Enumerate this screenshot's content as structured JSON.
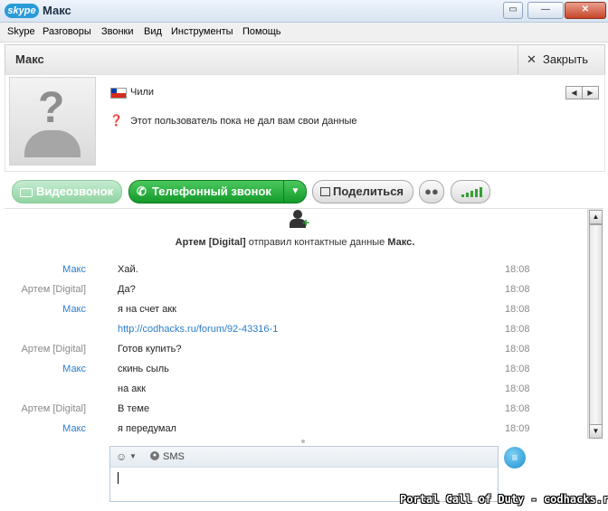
{
  "window": {
    "logo_text": "skype",
    "title": "Макс",
    "controls": [
      "▭",
      "—",
      "✕"
    ]
  },
  "menu": [
    "Skype",
    "Разговоры",
    "Звонки",
    "Вид",
    "Инструменты",
    "Помощь"
  ],
  "header": {
    "contact_name": "Макс",
    "close_label": "Закрыть"
  },
  "profile": {
    "country": "Чили",
    "info_text": "Этот пользователь пока не дал вам свои данные",
    "nav_prev": "◀",
    "nav_next": "▶"
  },
  "toolbar": {
    "video_call": "Видеозвонок",
    "phone_call": "Телефонный звонок",
    "share": "Поделиться"
  },
  "chat": {
    "system": {
      "sender": "Артем [Digital]",
      "text": "отправил контактные данные",
      "target": "Макс."
    },
    "messages": [
      {
        "sender": "Макс",
        "text": "Хай.",
        "time": "18:08"
      },
      {
        "sender": "Артем [Digital]",
        "text": "Да?",
        "time": "18:08"
      },
      {
        "sender": "Макс",
        "text": "я на счет акк",
        "time": "18:08"
      },
      {
        "sender": "",
        "text": "http://codhacks.ru/forum/92-43316-1",
        "time": "18:08"
      },
      {
        "sender": "Артем [Digital]",
        "text": "Готов купить?",
        "time": "18:08"
      },
      {
        "sender": "Макс",
        "text": "скинь сыль",
        "time": "18:08"
      },
      {
        "sender": "",
        "text": "на акк",
        "time": "18:08"
      },
      {
        "sender": "Артем [Digital]",
        "text": "В теме",
        "time": "18:08"
      },
      {
        "sender": "Макс",
        "text": "я передумал",
        "time": "18:09"
      }
    ]
  },
  "compose": {
    "sms_label": "SMS"
  },
  "watermark": "Portal Call of Duty - codhacks.ru",
  "colors": {
    "accent_blue": "#2b7ecd",
    "call_green": "#129a2a"
  }
}
